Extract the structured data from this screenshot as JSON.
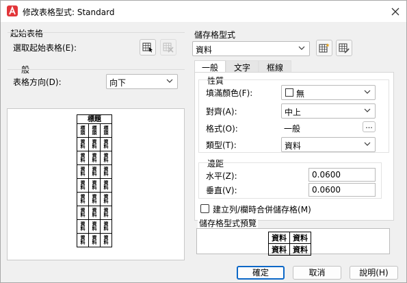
{
  "window": {
    "title": "修改表格型式: Standard"
  },
  "left": {
    "start_table": {
      "group_label": "起始表格",
      "select_label": "選取起始表格(E):"
    },
    "general": {
      "group_label": "一般",
      "direction_label": "表格方向(D):",
      "direction_value": "向下"
    },
    "preview": {
      "title": "標題",
      "header": [
        "標\n頭",
        "標\n頭",
        "標\n頭"
      ],
      "cell": "資\n料",
      "rows": 8
    }
  },
  "right": {
    "cell_style": {
      "group_label": "儲存格型式",
      "selected": "資料"
    },
    "tabs": [
      "一般",
      "文字",
      "框線"
    ],
    "properties": {
      "group_label": "性質",
      "fill_color_label": "填滿顏色(F):",
      "fill_color_value": "無",
      "alignment_label": "對齊(A):",
      "alignment_value": "中上",
      "format_label": "格式(O):",
      "format_value": "一般",
      "format_button": "...",
      "type_label": "類型(T):",
      "type_value": "資料"
    },
    "margins": {
      "group_label": "邊距",
      "horizontal_label": "水平(Z):",
      "horizontal_value": "0.0600",
      "vertical_label": "垂直(V):",
      "vertical_value": "0.0600"
    },
    "merge_checkbox": {
      "label": "建立列/欄時合併儲存格(M)",
      "checked": false
    },
    "cell_preview": {
      "group_label": "儲存格型式預覽",
      "cell": "資料"
    }
  },
  "buttons": {
    "ok": "確定",
    "cancel": "取消",
    "help": "說明(H)"
  },
  "colors": {
    "accent": "#0b67c7",
    "app_icon": "#e2363a"
  },
  "icons": {
    "app": "autocad-a-icon",
    "close": "close-icon",
    "select_table": "select-table-icon",
    "delete_table": "delete-table-icon",
    "new_cell_style": "new-cell-style-icon",
    "manage_cell_style": "manage-cell-styles-icon"
  }
}
